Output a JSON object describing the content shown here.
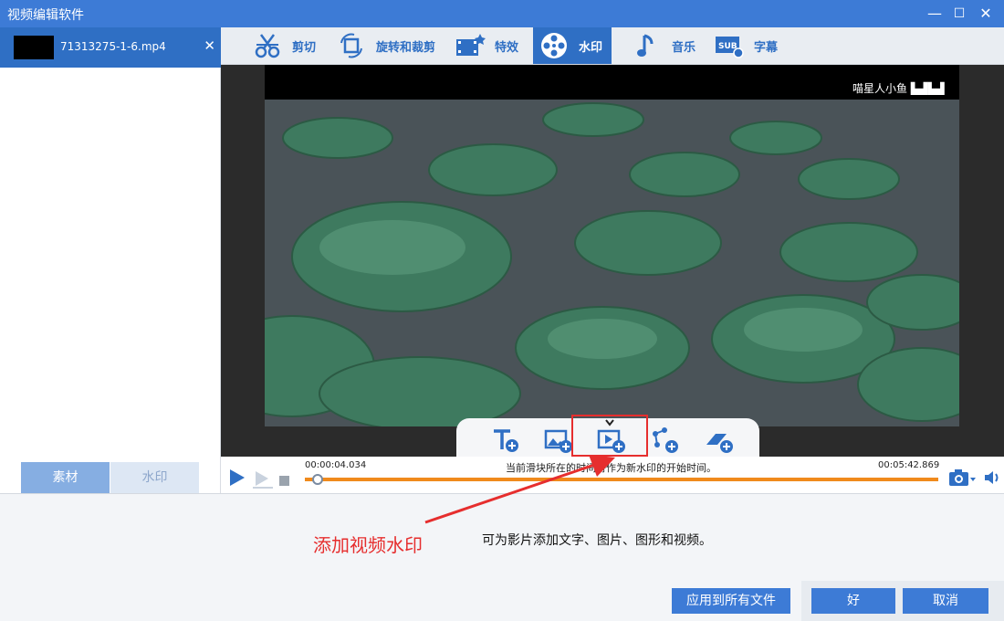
{
  "window": {
    "title": "视频编辑软件"
  },
  "window_controls": {
    "minimize": "—",
    "maximize": "☐",
    "close": "✕"
  },
  "sidebar": {
    "file_name": "71313275-1-6.mp4",
    "close_glyph": "✕",
    "tabs": [
      "素材",
      "水印"
    ]
  },
  "toolbar": {
    "tools": [
      {
        "label": "剪切",
        "icon": "scissors-icon"
      },
      {
        "label": "旋转和裁剪",
        "icon": "rotate-crop-icon"
      },
      {
        "label": "特效",
        "icon": "effects-icon"
      },
      {
        "label": "水印",
        "icon": "watermark-film-icon"
      },
      {
        "label": "音乐",
        "icon": "music-note-icon"
      },
      {
        "label": "字幕",
        "icon": "subtitle-icon"
      }
    ],
    "subtitle_badge": "SUB",
    "active": "水印"
  },
  "video": {
    "watermark_text": "喵星人小鱼 ▙▟▙▟"
  },
  "watermark_tools": [
    "add-text-icon",
    "add-image-icon",
    "add-video-icon",
    "add-shape-icon",
    "add-eraser-icon"
  ],
  "timeline": {
    "current_time": "00:00:04.034",
    "total_time": "00:05:42.869",
    "hint": "当前滑块所在的时间将作为新水印的开始时间。",
    "progress": 0.012
  },
  "bottom": {
    "description": "可为影片添加文字、图片、图形和视频。",
    "annotation": "添加视频水印",
    "apply_all": "应用到所有文件",
    "ok": "好",
    "cancel": "取消"
  },
  "colors": {
    "accent": "#3d7bd6",
    "annotation": "#e62e2e",
    "timeline": "#f08a1c"
  }
}
